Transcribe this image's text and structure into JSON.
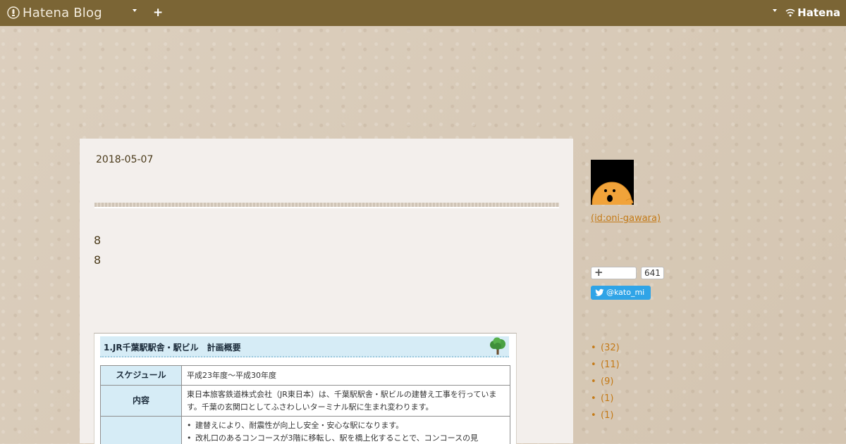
{
  "topbar": {
    "brand": "Hatena Blog",
    "plus_label": "+",
    "hatena_label": "Hatena"
  },
  "entry": {
    "date": "2018-05-07",
    "lines": [
      "8",
      "8"
    ],
    "figure": {
      "title": "1.JR千葉駅駅舎・駅ビル　計画概要",
      "rows": [
        {
          "header": "スケジュール",
          "content": "平成23年度～平成30年度"
        },
        {
          "header": "内容",
          "content": "東日本旅客鉄道株式会社（JR東日本）は、千葉駅駅舎・駅ビルの建替え工事を行っています。千葉の玄関口としてふさわしいターミナル駅に生まれ変わります。"
        },
        {
          "header": "",
          "bullets": [
            "建替えにより、耐震性が向上し安全・安心な駅になります。",
            "改札口のあるコンコースが3階に移転し、駅を橋上化することで、コンコースの見"
          ]
        }
      ]
    }
  },
  "sidebar": {
    "profile": " (id:oni-gawara)",
    "bookmark_count": "641",
    "twitter_label": "@kato_mi",
    "categories": [
      {
        "bullet": "•",
        "count": "(32)"
      },
      {
        "bullet": "•",
        "count": "(11)"
      },
      {
        "bullet": "•",
        "count": "(9)"
      },
      {
        "bullet": "•",
        "count": "(1)"
      },
      {
        "bullet": "•",
        "count": "(1)"
      }
    ]
  }
}
